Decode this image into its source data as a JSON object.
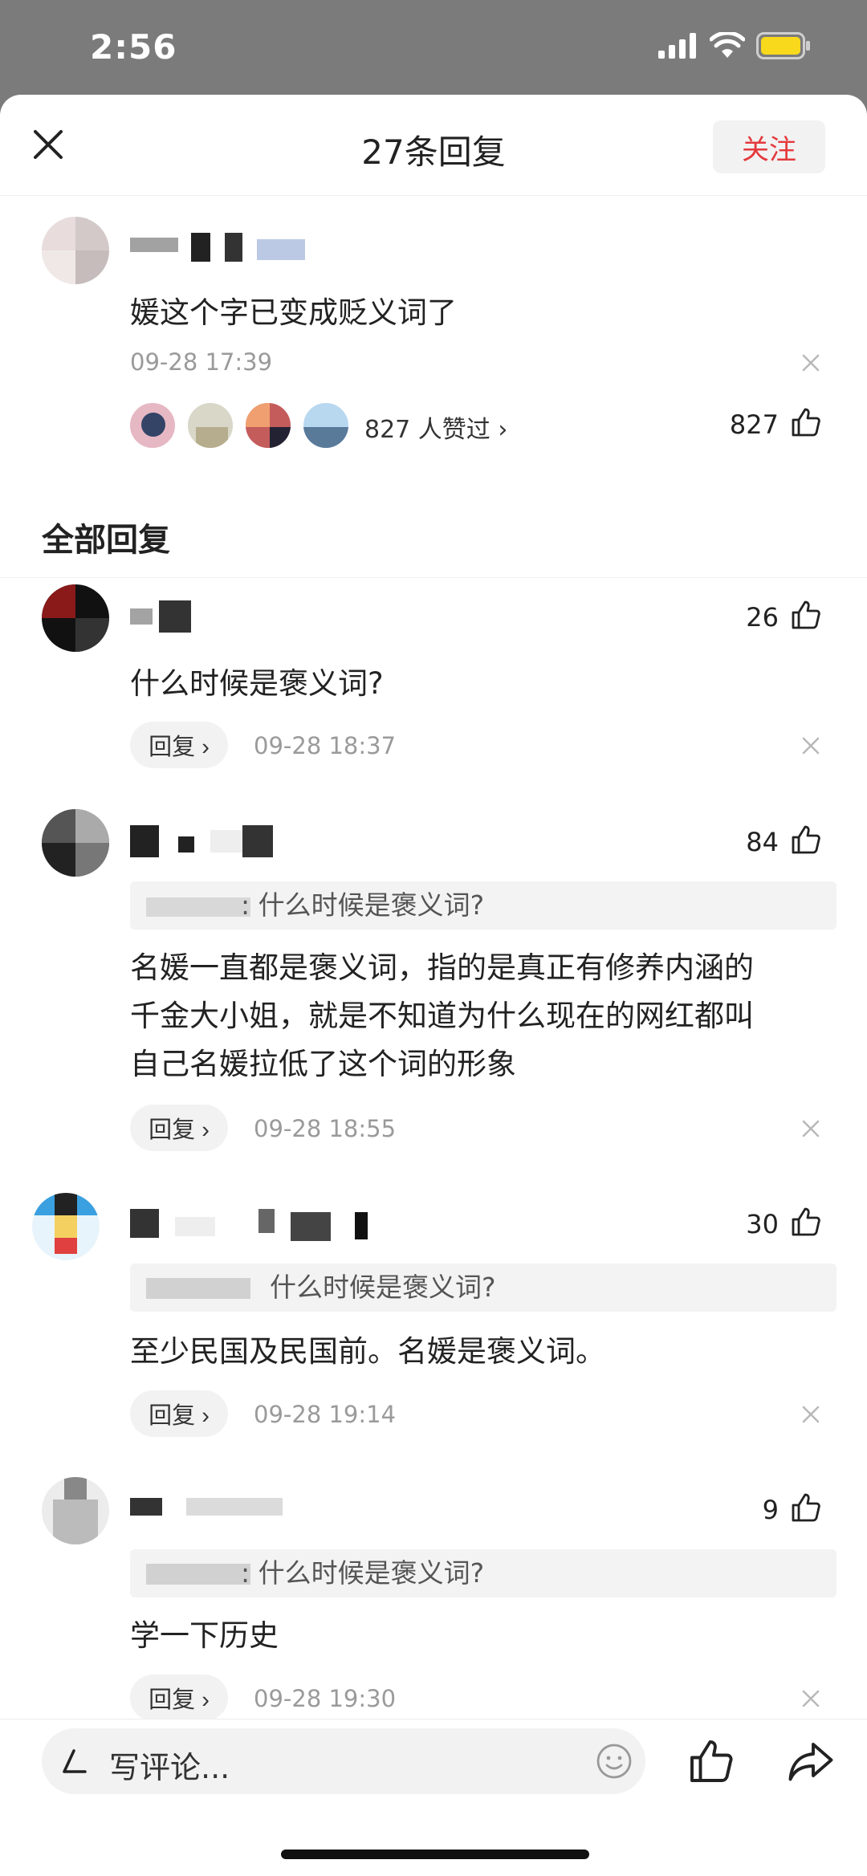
{
  "status_bar": {
    "time": "2:56"
  },
  "header": {
    "title": "27条回复"
  },
  "main_comment": {
    "follow_label": "关注",
    "text": "媛这个字已变成贬义词了",
    "time": "09-28 17:39",
    "liked_by": "827 人赞过 ›",
    "like_count": "827"
  },
  "section_title": "全部回复",
  "replies": [
    {
      "text": "什么时候是褒义词?",
      "time": "09-28 18:37",
      "reply_label": "回复 ›",
      "like_count": "26"
    },
    {
      "quote": ": 什么时候是褒义词?",
      "text_lines": [
        "名媛一直都是褒义词，指的是真正有修养内涵的",
        "千金大小姐，就是不知道为什么现在的网红都叫",
        "自己名媛拉低了这个词的形象"
      ],
      "time": "09-28 18:55",
      "reply_label": "回复 ›",
      "like_count": "84"
    },
    {
      "quote": "什么时候是褒义词?",
      "text": "至少民国及民国前。名媛是褒义词。",
      "time": "09-28 19:14",
      "reply_label": "回复 ›",
      "like_count": "30"
    },
    {
      "quote": ": 什么时候是褒义词?",
      "text": "学一下历史",
      "time": "09-28 19:30",
      "reply_label": "回复 ›",
      "like_count": "9"
    }
  ],
  "bottom_bar": {
    "placeholder": "写评论..."
  },
  "colors": {
    "accent": "#e4393c",
    "chip_bg": "#f2f2f2",
    "muted": "#9a9a9a"
  }
}
